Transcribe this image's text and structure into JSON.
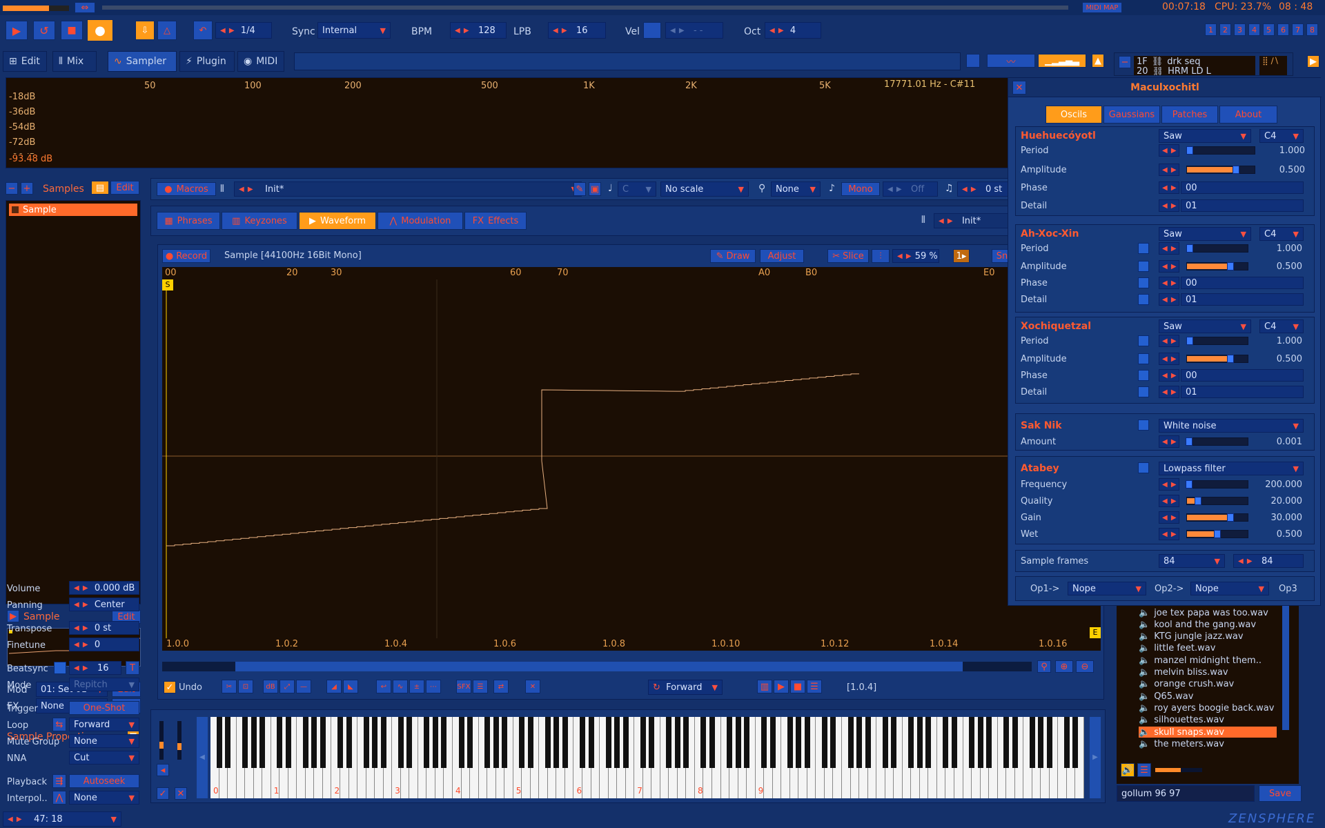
{
  "transport": {
    "quant": "1/4",
    "sync_label": "Sync",
    "sync_value": "Internal",
    "bpm_label": "BPM",
    "bpm_value": "128",
    "lpb_label": "LPB",
    "lpb_value": "16",
    "vel_label": "Vel",
    "vel_value": "- -",
    "oct_label": "Oct",
    "oct_value": "4",
    "midimap": "MIDI MAP",
    "time": "00:07:18",
    "cpu": "CPU: 23.7%",
    "clock": "08 : 48",
    "numbers": [
      "1",
      "2",
      "3",
      "4",
      "5",
      "6",
      "7",
      "8"
    ]
  },
  "top_tabs": {
    "edit": "Edit",
    "mix": "Mix",
    "sampler": "Sampler",
    "plugin": "Plugin",
    "midi": "MIDI"
  },
  "tracks_mini": [
    {
      "num": "1F",
      "name": "drk seq"
    },
    {
      "num": "20",
      "name": "HRM LD L"
    }
  ],
  "spectrum": {
    "db_labels": [
      "-18dB",
      "-36dB",
      "-54dB",
      "-72dB",
      "-90dB"
    ],
    "db_readout": "-93.48 dB",
    "freq_labels": [
      "50",
      "100",
      "200",
      "500",
      "1K",
      "2K",
      "5K"
    ],
    "hz_readout": "17771.01 Hz - C#11"
  },
  "left": {
    "samples_title": "Samples",
    "edit": "Edit",
    "sample_item": "Sample",
    "sample_sub": "Sample",
    "mod_label": "Mod",
    "mod_value": "01: Set 01",
    "fx_label": "FX",
    "fx_value": "None",
    "props_title": "Sample Properties",
    "volume_label": "Volume",
    "volume_value": "0.000 dB",
    "panning_label": "Panning",
    "panning_value": "Center",
    "transpose_label": "Transpose",
    "transpose_value": "0 st",
    "finetune_label": "Finetune",
    "finetune_value": "0",
    "beatsync_label": "Beatsync",
    "beatsync_value": "16",
    "beatsync_t": "T",
    "mode_label": "Mode",
    "mode_value": "Repitch",
    "trigger_label": "Trigger",
    "trigger_value": "One-Shot",
    "loop_label": "Loop",
    "loop_value": "Forward",
    "mute_label": "Mute Group",
    "mute_value": "None",
    "nna_label": "NNA",
    "nna_value": "Cut",
    "playback_label": "Playback",
    "playback_value": "Autoseek",
    "interp_label": "Interpol..",
    "interp_value": "None",
    "status": "47: 18"
  },
  "macros": {
    "macros_label": "Macros",
    "preset": "Init*",
    "key": "C",
    "scale": "No scale",
    "none": "None",
    "mono": "Mono",
    "off": "Off",
    "st": "0 st"
  },
  "subtabs": {
    "phrases": "Phrases",
    "keyzones": "Keyzones",
    "waveform": "Waveform",
    "modulation": "Modulation",
    "effects": "Effects",
    "preset2": "Init*"
  },
  "waveform": {
    "record": "Record",
    "info": "Sample [44100Hz 16Bit Mono]",
    "draw": "Draw",
    "adjust": "Adjust",
    "slice": "Slice",
    "zoom": "59 %",
    "sn": "Sn",
    "ruler_top": [
      "00",
      "20",
      "30",
      "60",
      "70",
      "A0",
      "B0",
      "E0"
    ],
    "ruler_bottom": [
      "1.0.0",
      "1.0.2",
      "1.0.4",
      "1.0.6",
      "1.0.8",
      "1.0.10",
      "1.0.12",
      "1.0.14",
      "1.0.16"
    ],
    "start_marker": "S",
    "end_marker": "E",
    "undo": "Undo",
    "forward": "Forward",
    "position": "[1.0.4]"
  },
  "piano": {
    "octaves": [
      "0",
      "1",
      "2",
      "3",
      "4",
      "5",
      "6",
      "7",
      "8",
      "9"
    ]
  },
  "plugin": {
    "title": "Maculxochitl",
    "tabs": [
      "Oscils",
      "Gaussians",
      "Patches",
      "About"
    ],
    "osc1": {
      "name": "Huehuecóyotl",
      "wave": "Saw",
      "note": "C4",
      "period": "1.000",
      "amplitude": "0.500",
      "phase": "00",
      "detail": "01"
    },
    "osc2": {
      "name": "Ah-Xoc-Xin",
      "wave": "Saw",
      "note": "C4",
      "period": "1.000",
      "amplitude": "0.500",
      "phase": "00",
      "detail": "01"
    },
    "osc3": {
      "name": "Xochiquetzal",
      "wave": "Saw",
      "note": "C4",
      "period": "1.000",
      "amplitude": "0.500",
      "phase": "00",
      "detail": "01"
    },
    "labels": {
      "period": "Period",
      "amplitude": "Amplitude",
      "phase": "Phase",
      "detail": "Detail"
    },
    "noise": {
      "name": "Sak Nik",
      "type": "White noise",
      "amount_label": "Amount",
      "amount": "0.001"
    },
    "filter": {
      "name": "Atabey",
      "type": "Lowpass filter",
      "freq_label": "Frequency",
      "freq": "200.000",
      "q_label": "Quality",
      "q": "20.000",
      "gain_label": "Gain",
      "gain": "30.000",
      "wet_label": "Wet",
      "wet": "0.500"
    },
    "frames_label": "Sample frames",
    "frames_a": "84",
    "frames_b": "84",
    "op1": "Op1->",
    "op1_value": "Nope",
    "op2": "Op2->",
    "op2_value": "Nope",
    "op3": "Op3"
  },
  "browser": {
    "files": [
      "joe tex papa was too.wav",
      "kool and the gang.wav",
      "KTG jungle jazz.wav",
      "little feet.wav",
      "manzel midnight them..",
      "melvin bliss.wav",
      "orange crush.wav",
      "Q65.wav",
      "roy ayers boogie back.wav",
      "silhouettes.wav",
      "skull snaps.wav",
      "the meters.wav"
    ],
    "selected_index": 10,
    "search": "gollum 96 97",
    "save": "Save"
  },
  "logo": "ZENSPHERE"
}
